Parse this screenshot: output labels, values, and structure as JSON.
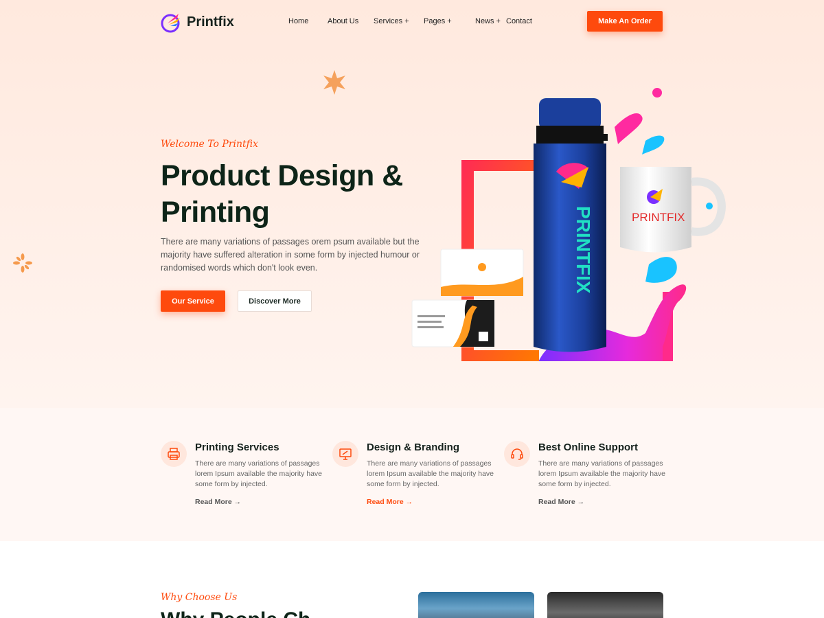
{
  "brand": {
    "name": "Printfix",
    "accent": "#fe4a0d",
    "dark": "#0d2418"
  },
  "nav": {
    "items": [
      "Home",
      "About Us",
      "Services +",
      "Pages +",
      "News +",
      "Contact"
    ],
    "cta": "Make An Order"
  },
  "hero": {
    "subtitle": "Welcome To Printfix",
    "title": "Product Design & Printing",
    "description": "There are many variations of passages orem psum available but the majority have suffered alteration in some form by injected humour or randomised words which don't look even.",
    "primary_button": "Our Service",
    "secondary_button": "Discover More",
    "product_bottle_text": "PRINTFIX",
    "product_mug_text": "PRINTFIX"
  },
  "features": [
    {
      "icon": "printer-icon",
      "title": "Printing Services",
      "text": "There are many variations of passages lorem Ipsum available the majority have some form by injected.",
      "link": "Read More →",
      "highlighted": false
    },
    {
      "icon": "design-monitor-icon",
      "title": "Design & Branding",
      "text": "There are many variations of passages lorem Ipsum available the majority have some form by injected.",
      "link": "Read More →",
      "highlighted": true
    },
    {
      "icon": "headset-icon",
      "title": "Best Online Support",
      "text": "There are many variations of passages lorem Ipsum available the majority have some form by injected.",
      "link": "Read More →",
      "highlighted": false
    }
  ],
  "why": {
    "subtitle": "Why Choose Us",
    "title": "Why People Ch"
  }
}
